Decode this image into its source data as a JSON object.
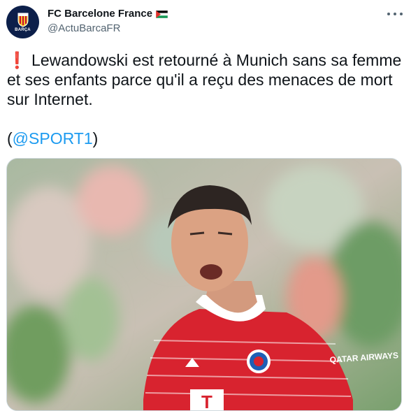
{
  "account": {
    "display_name": "FC Barcelone France",
    "handle": "@ActuBarcaFR",
    "avatar_text": "BARÇA"
  },
  "tweet": {
    "emoji": "❗",
    "text_line": "Lewandowski est retourné à Munich sans sa femme et ses enfants parce qu'il a reçu des menaces de mort sur Internet.",
    "source_open": "(",
    "source_mention": "@SPORT1",
    "source_close": ")"
  },
  "media": {
    "kit_sponsor": "T",
    "sleeve_sponsor": "QATAR AIRWAYS"
  },
  "colors": {
    "mention": "#1d9bf0",
    "secondary_text": "#536471",
    "border": "#cfd9de"
  }
}
